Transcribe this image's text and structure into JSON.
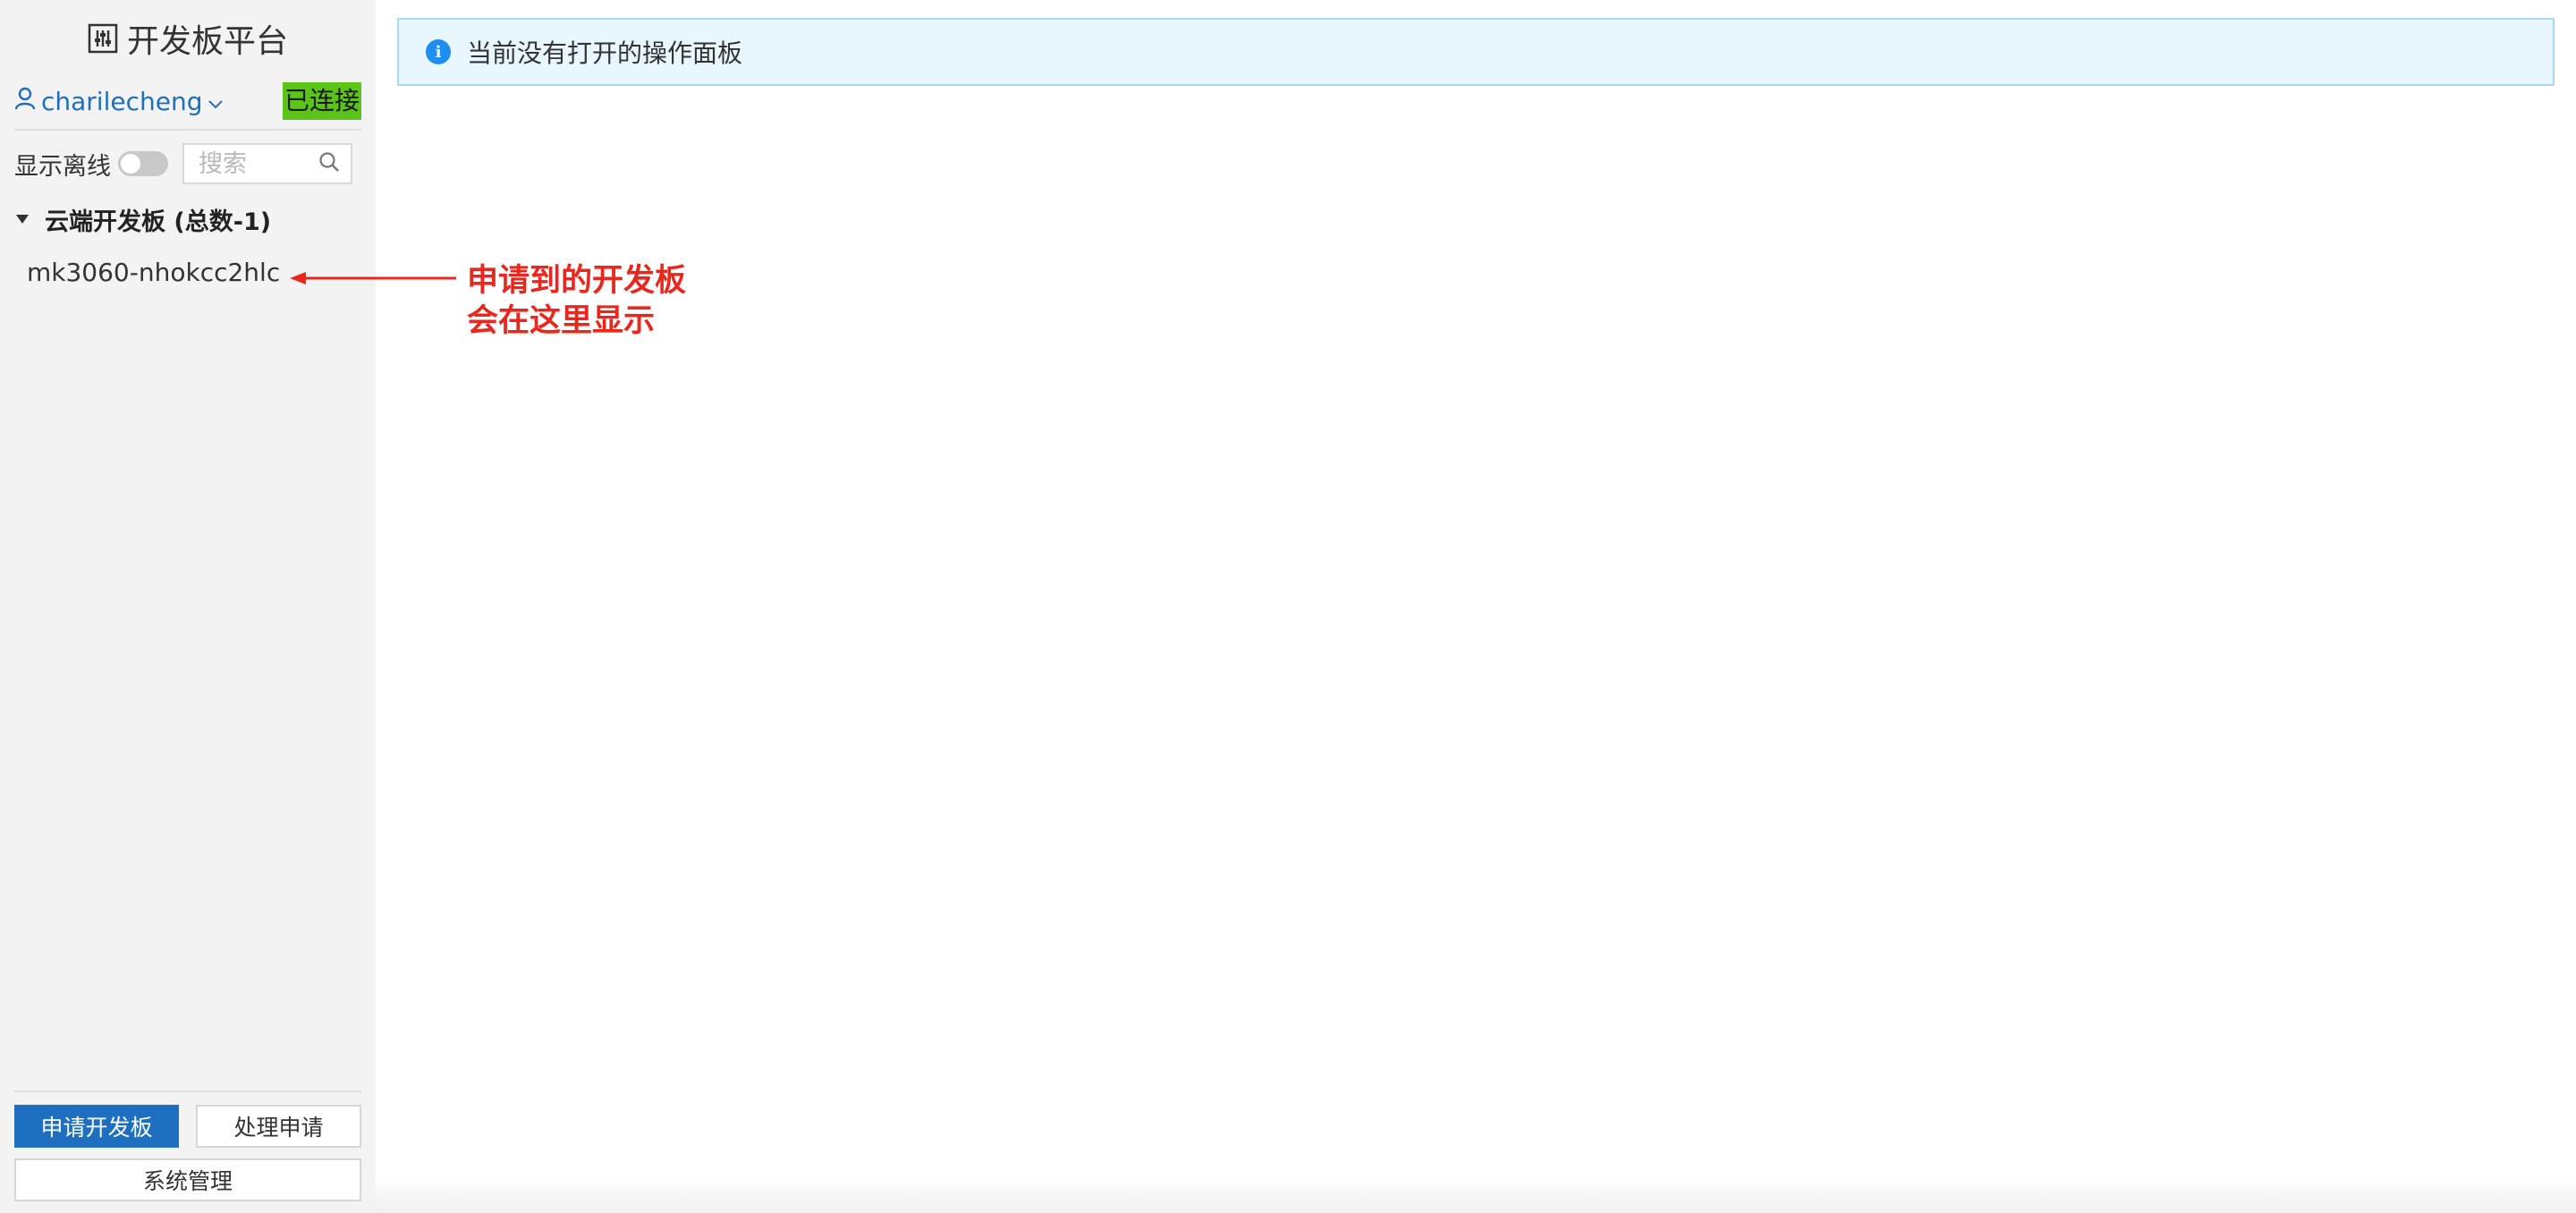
{
  "sidebar": {
    "brand_title": "开发板平台",
    "brand_icon": "sliders-icon",
    "username": "charilecheng",
    "user_icon": "user-icon",
    "connection_status": "已连接",
    "offline_toggle_label": "显示离线",
    "offline_toggle_on": false,
    "search_placeholder": "搜索",
    "search_value": "",
    "tree": {
      "group_label": "云端开发板 (总数-1)",
      "expanded": true,
      "items": [
        "mk3060-nhokcc2hlc"
      ]
    },
    "buttons": {
      "apply": "申请开发板",
      "handle": "处理申请",
      "system": "系统管理"
    }
  },
  "main": {
    "notice": "当前没有打开的操作面板"
  },
  "annotation": {
    "line1": "申请到的开发板",
    "line2": "会在这里显示"
  },
  "colors": {
    "primary": "#1f6fc0",
    "connected_badge": "#5bc41b",
    "alert_bg": "#e8f6fd",
    "alert_border": "#a6d9f3",
    "annotation": "#e8281e",
    "sidebar_bg": "#f3f3f3"
  }
}
